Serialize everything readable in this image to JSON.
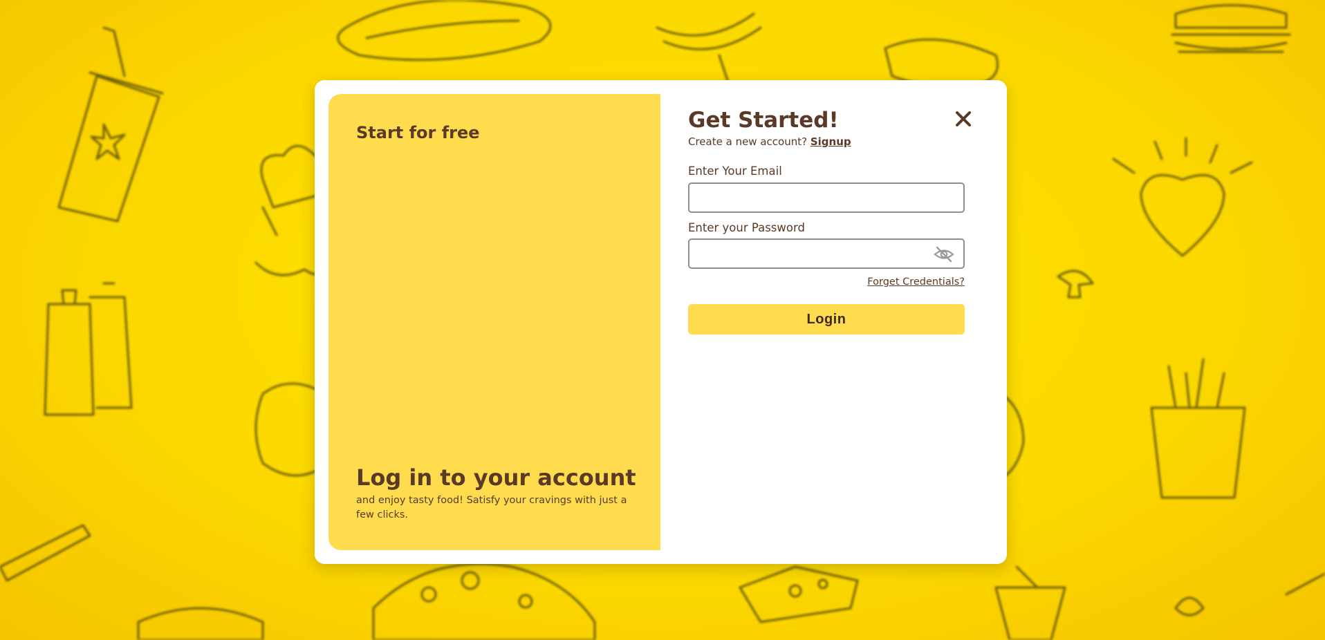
{
  "promo": {
    "title": "Start for free",
    "heading": "Log in to your account",
    "subtext": "and enjoy tasty food! Satisfy your cravings with just a few clicks."
  },
  "form": {
    "title": "Get Started!",
    "signup_prompt": "Create a new account?",
    "signup_link": "Signup",
    "email_label": "Enter Your Email",
    "email_value": "",
    "password_label": "Enter your Password",
    "password_value": "",
    "forgot_link": "Forget Credentials?",
    "login_label": "Login"
  },
  "icons": {
    "close": "close-icon",
    "password_toggle": "eye-off-icon"
  },
  "colors": {
    "background": "#fcd900",
    "panel": "#fedc4d",
    "text": "#5a3a26",
    "modal": "#ffffff"
  }
}
